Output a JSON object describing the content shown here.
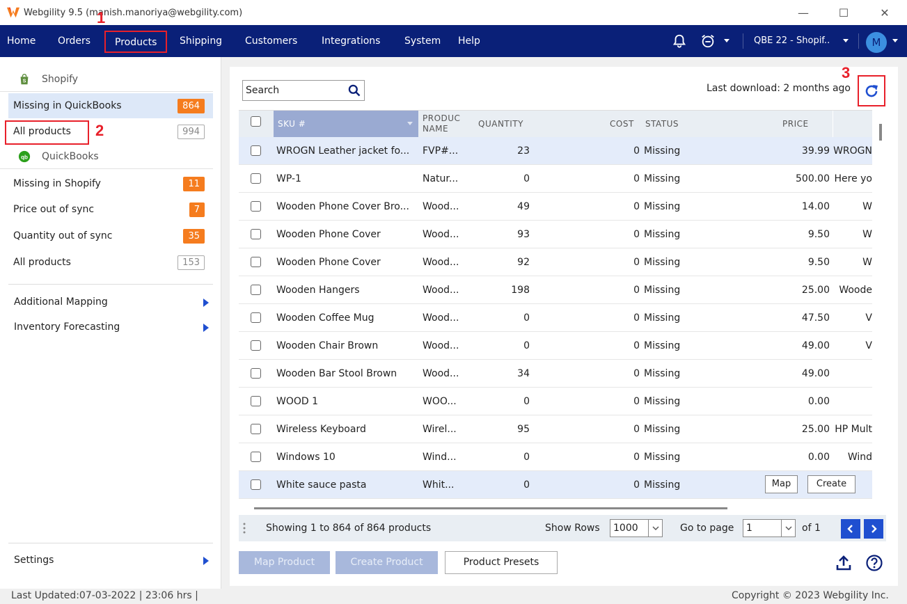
{
  "window": {
    "title": "Webgility 9.5 (manish.manoriya@webgility.com)",
    "controls": {
      "minimize": "—",
      "maximize": "☐",
      "close": "✕"
    }
  },
  "nav": {
    "items": [
      "Home",
      "Orders",
      "Products",
      "Shipping",
      "Customers",
      "Integrations",
      "System",
      "Help"
    ],
    "active": "Products",
    "profile": "QBE 22 - Shopif..",
    "avatar": "M",
    "icons": [
      "bell-icon",
      "alarm-clock-icon"
    ]
  },
  "annotations": {
    "one": "1",
    "two": "2",
    "three": "3"
  },
  "sidebar": {
    "shopify_label": "Shopify",
    "shopify_items": [
      {
        "label": "Missing in QuickBooks",
        "count": "864"
      },
      {
        "label": "All products",
        "count": "994"
      }
    ],
    "quickbooks_label": "QuickBooks",
    "quickbooks_items": [
      {
        "label": "Missing in Shopify",
        "count": "11"
      },
      {
        "label": "Price out of sync",
        "count": "7"
      },
      {
        "label": "Quantity out of sync",
        "count": "35"
      },
      {
        "label": "All products",
        "count": "153"
      }
    ],
    "links": [
      "Additional Mapping",
      "Inventory Forecasting"
    ],
    "settings": "Settings"
  },
  "search": {
    "placeholder": "Search"
  },
  "last_download": "Last download: 2 months ago",
  "table": {
    "columns": {
      "sku": "SKU #",
      "product_name_1": "PRODUC",
      "product_name_2": "NAME",
      "quantity": "QUANTITY",
      "cost": "COST",
      "status": "STATUS",
      "price": "PRICE"
    },
    "rows": [
      {
        "sku": "WROGN Leather jacket fo...",
        "name": "FVP#...",
        "qty": "23",
        "cost": "0",
        "status": "Missing",
        "price": "39.99",
        "extra": "WROGN"
      },
      {
        "sku": "WP-1",
        "name": "Natur...",
        "qty": "0",
        "cost": "0",
        "status": "Missing",
        "price": "500.00",
        "extra": "Here yo"
      },
      {
        "sku": "Wooden Phone Cover Bro...",
        "name": "Wood...",
        "qty": "49",
        "cost": "0",
        "status": "Missing",
        "price": "14.00",
        "extra": "W"
      },
      {
        "sku": "Wooden Phone Cover",
        "name": "Wood...",
        "qty": "93",
        "cost": "0",
        "status": "Missing",
        "price": "9.50",
        "extra": "W"
      },
      {
        "sku": "Wooden Phone Cover",
        "name": "Wood...",
        "qty": "92",
        "cost": "0",
        "status": "Missing",
        "price": "9.50",
        "extra": "W"
      },
      {
        "sku": "Wooden Hangers",
        "name": "Wood...",
        "qty": "198",
        "cost": "0",
        "status": "Missing",
        "price": "25.00",
        "extra": "Woode"
      },
      {
        "sku": "Wooden Coffee Mug",
        "name": "Wood...",
        "qty": "0",
        "cost": "0",
        "status": "Missing",
        "price": "47.50",
        "extra": "V"
      },
      {
        "sku": "Wooden Chair Brown",
        "name": "Wood...",
        "qty": "0",
        "cost": "0",
        "status": "Missing",
        "price": "49.00",
        "extra": "V"
      },
      {
        "sku": "Wooden Bar Stool Brown",
        "name": "Wood...",
        "qty": "34",
        "cost": "0",
        "status": "Missing",
        "price": "49.00",
        "extra": ""
      },
      {
        "sku": "WOOD 1",
        "name": "WOO...",
        "qty": "0",
        "cost": "0",
        "status": "Missing",
        "price": "0.00",
        "extra": ""
      },
      {
        "sku": "Wireless Keyboard",
        "name": "Wirel...",
        "qty": "95",
        "cost": "0",
        "status": "Missing",
        "price": "25.00",
        "extra": "HP Mult"
      },
      {
        "sku": "Windows 10",
        "name": "Wind...",
        "qty": "0",
        "cost": "0",
        "status": "Missing",
        "price": "0.00",
        "extra": "Wind"
      },
      {
        "sku": "White sauce pasta",
        "name": "Whit...",
        "qty": "0",
        "cost": "0",
        "status": "Missing",
        "price": "",
        "extra": ""
      }
    ],
    "row_actions": {
      "map": "Map",
      "create": "Create"
    }
  },
  "pager": {
    "showing": "Showing 1 to 864 of 864 products",
    "show_rows_label": "Show Rows",
    "show_rows_value": "1000",
    "goto_label": "Go to page",
    "goto_value": "1",
    "of_label": "of 1"
  },
  "actions": {
    "map_product": "Map Product",
    "create_product": "Create Product",
    "product_presets": "Product Presets"
  },
  "status": {
    "last_updated": "Last Updated:07-03-2022 | 23:06 hrs |",
    "copyright": "Copyright © 2023 Webgility Inc."
  },
  "colors": {
    "nav_bg": "#0a2078",
    "accent": "#1f4fd0",
    "badge": "#f57c1e",
    "annotation": "#e8202a"
  }
}
